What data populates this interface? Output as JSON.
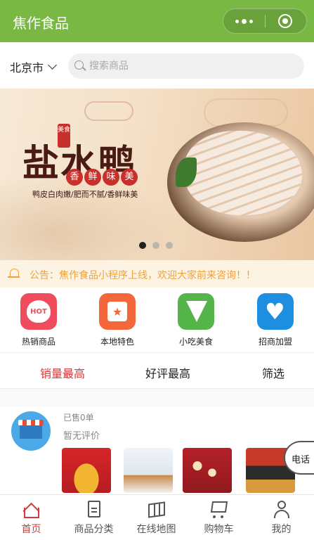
{
  "app": {
    "title": "焦作食品"
  },
  "location": {
    "city": "北京市"
  },
  "search": {
    "placeholder": "搜索商品"
  },
  "banner": {
    "title": "盐水鸭",
    "stamp": "美食",
    "seals": [
      "香",
      "鲜",
      "味",
      "美"
    ],
    "tagline": "鸭皮白肉嫩/肥而不腻/香鲜味美",
    "slides": 3,
    "active_slide": 1
  },
  "notice": {
    "text": "公告：焦作食品小程序上线，欢迎大家前来咨询！！"
  },
  "categories": [
    {
      "label": "热销商品",
      "icon": "hot-icon",
      "icon_text": "HOT",
      "color": "#ef4c5e"
    },
    {
      "label": "本地特色",
      "icon": "local-specialty-icon",
      "icon_text": "★",
      "color": "#f4673b"
    },
    {
      "label": "小吃美食",
      "icon": "snack-icon",
      "color": "#55b54b"
    },
    {
      "label": "招商加盟",
      "icon": "handshake-heart-icon",
      "icon_text": "♥",
      "color": "#1e8fe0"
    }
  ],
  "sort": {
    "options": [
      "销量最高",
      "好评最高",
      "筛选"
    ],
    "active": "销量最高",
    "active_color": "#d4383a"
  },
  "store": {
    "sold": "已售0单",
    "rating": "暂无评价"
  },
  "float_call": {
    "label": "电话"
  },
  "tabbar": {
    "items": [
      {
        "label": "首页",
        "icon": "home-icon"
      },
      {
        "label": "商品分类",
        "icon": "category-icon"
      },
      {
        "label": "在线地图",
        "icon": "map-icon"
      },
      {
        "label": "购物车",
        "icon": "cart-icon"
      },
      {
        "label": "我的",
        "icon": "user-icon"
      }
    ],
    "active": "首页"
  },
  "colors": {
    "brand": "#78b843",
    "accent": "#d4383a",
    "notice": "#f0a13c"
  }
}
